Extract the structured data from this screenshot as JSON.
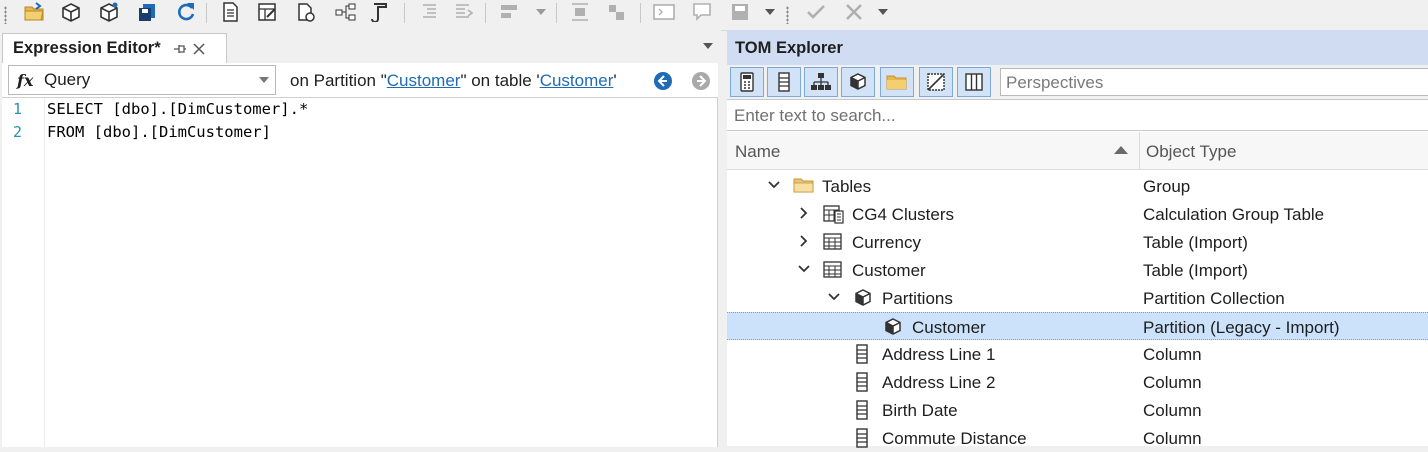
{
  "toolbar": {
    "icons": [
      "open-folder-icon",
      "deploy-model-icon",
      "database-icon",
      "save-icon",
      "refresh-icon",
      "document-icon",
      "table-edit-icon",
      "script-icon",
      "hierarchy-icon",
      "sql-icon",
      "indent-icon",
      "outdent-icon",
      "align-icon",
      "align-center-icon",
      "move-icon",
      "query-icon",
      "comment-icon",
      "save-disabled-icon",
      "check-icon",
      "cancel-icon"
    ]
  },
  "editor": {
    "tab_title": "Expression Editor*",
    "combo_value": "Query",
    "context_prefix": "on Partition \"",
    "partition_name": "Customer",
    "context_middle": "\" on table '",
    "table_name": "Customer",
    "context_suffix": "'",
    "lines": [
      {
        "num": "1",
        "text": "SELECT [dbo].[DimCustomer].*"
      },
      {
        "num": "2",
        "text": "FROM [dbo].[DimCustomer]"
      }
    ]
  },
  "tom": {
    "title": "TOM Explorer",
    "perspectives_placeholder": "Perspectives",
    "search_placeholder": "Enter text to search...",
    "columns": {
      "name": "Name",
      "type": "Object Type"
    },
    "rows": [
      {
        "label": "Tables",
        "type": "Group",
        "icon": "folder-icon",
        "expander": "expanded"
      },
      {
        "label": "CG4 Clusters",
        "type": "Calculation Group Table",
        "icon": "calc-table-icon",
        "expander": "collapsed"
      },
      {
        "label": "Currency",
        "type": "Table (Import)",
        "icon": "table-icon",
        "expander": "collapsed"
      },
      {
        "label": "Customer",
        "type": "Table (Import)",
        "icon": "table-icon",
        "expander": "expanded"
      },
      {
        "label": "Partitions",
        "type": "Partition Collection",
        "icon": "partition-icon",
        "expander": "expanded"
      },
      {
        "label": "Customer",
        "type": "Partition (Legacy - Import)",
        "icon": "partition-icon",
        "expander": "none",
        "selected": true
      },
      {
        "label": "Address Line 1",
        "type": "Column",
        "icon": "column-icon",
        "expander": "none"
      },
      {
        "label": "Address Line 2",
        "type": "Column",
        "icon": "column-icon",
        "expander": "none"
      },
      {
        "label": "Birth Date",
        "type": "Column",
        "icon": "column-icon",
        "expander": "none"
      },
      {
        "label": "Commute Distance",
        "type": "Column",
        "icon": "column-icon",
        "expander": "none"
      }
    ]
  },
  "colors": {
    "link": "#1f6bb5",
    "line_number": "#2b91af",
    "header_bg": "#cfdcf2",
    "selection": "#cce2fb"
  }
}
